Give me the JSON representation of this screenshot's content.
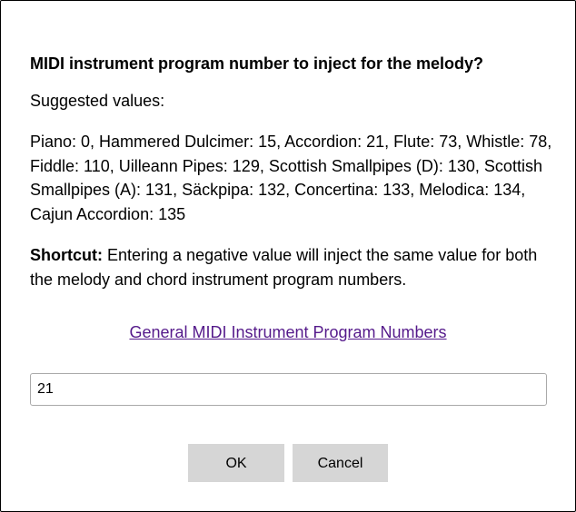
{
  "dialog": {
    "title": "MIDI instrument program number to inject for the melody?",
    "suggested_label": "Suggested values:",
    "suggested_values": "Piano: 0, Hammered Dulcimer: 15, Accordion: 21, Flute: 73, Whistle: 78, Fiddle: 110, Uilleann Pipes: 129, Scottish Smallpipes (D): 130, Scottish Smallpipes (A): 131, Säckpipa: 132, Concertina: 133, Melodica: 134, Cajun Accordion: 135",
    "shortcut_label": "Shortcut:",
    "shortcut_text": " Entering a negative value will inject the same value for both the melody and chord instrument program numbers.",
    "link_text": "General MIDI Instrument Program Numbers",
    "input_value": "21",
    "ok_label": "OK",
    "cancel_label": "Cancel"
  },
  "colors": {
    "link": "#551a8b",
    "button_bg": "#d6d6d6",
    "border": "#000000"
  }
}
